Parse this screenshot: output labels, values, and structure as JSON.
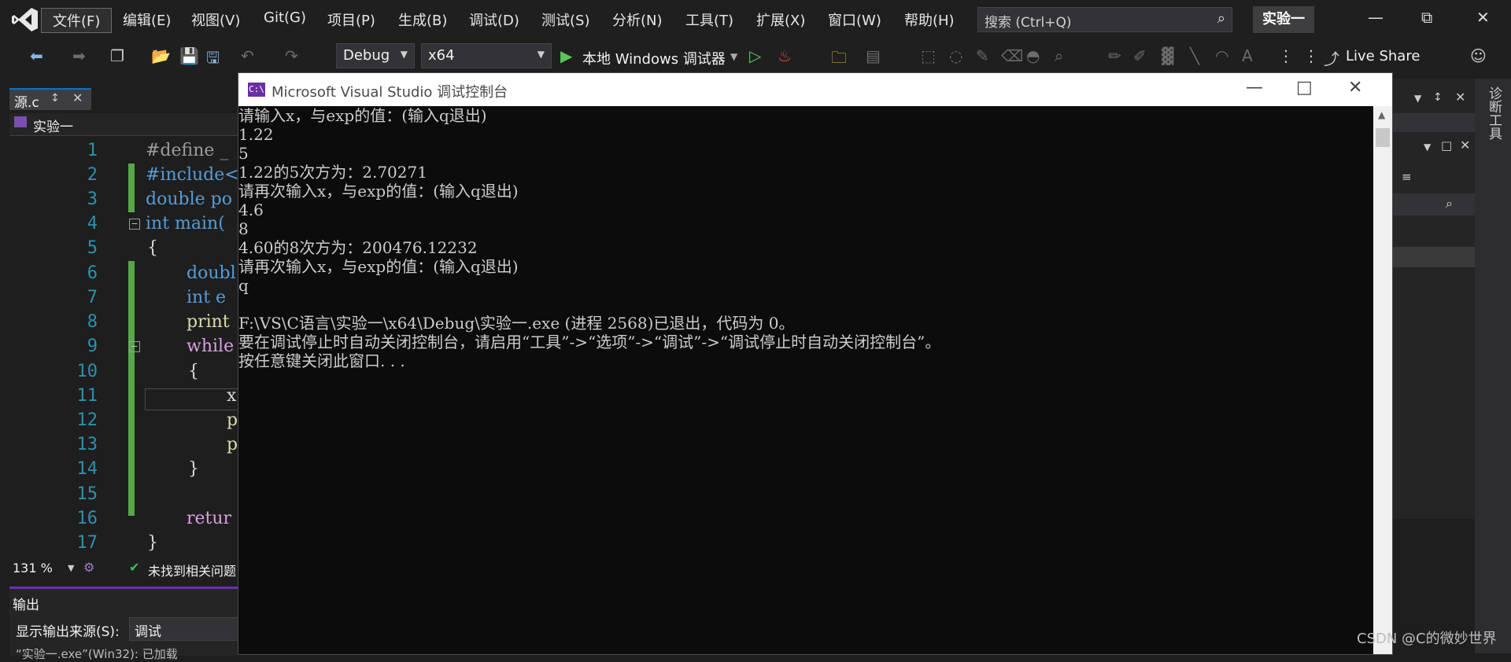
{
  "menubar": {
    "items": [
      "文件(F)",
      "编辑(E)",
      "视图(V)",
      "Git(G)",
      "项目(P)",
      "生成(B)",
      "调试(D)",
      "测试(S)",
      "分析(N)",
      "工具(T)",
      "扩展(X)",
      "窗口(W)",
      "帮助(H)"
    ],
    "search_placeholder": "搜索 (Ctrl+Q)",
    "solution_name": "实验一"
  },
  "toolbar": {
    "configuration": "Debug",
    "platform": "x64",
    "run_label": "本地 Windows 调试器",
    "live_share": "Live Share"
  },
  "editor": {
    "tab_label": "源.c",
    "nav_project": "实验一",
    "line_numbers": [
      "1",
      "2",
      "3",
      "4",
      "5",
      "6",
      "7",
      "8",
      "9",
      "10",
      "11",
      "12",
      "13",
      "14",
      "15",
      "16",
      "17"
    ],
    "lines": [
      "#define _",
      "#include<",
      "double po",
      "int main(",
      "{",
      "doubl",
      "int e",
      "print",
      "while",
      "{",
      "x",
      "p",
      "p",
      "}",
      "",
      "retur",
      "}"
    ],
    "zoom": "131 %",
    "status": "未找到相关问题"
  },
  "output": {
    "title": "输出",
    "source_label": "显示输出来源(S):",
    "source_value": "调试",
    "partial_line": "“实验一.exe”(Win32): 已加载"
  },
  "right_panel": {
    "diagnostics_label": "诊断工具"
  },
  "console": {
    "title": "Microsoft Visual Studio 调试控制台",
    "lines": [
      "请输入x，与exp的值：(输入q退出)",
      "1.22",
      "5",
      "1.22的5次方为：2.70271",
      "请再次输入x，与exp的值：(输入q退出)",
      "4.6",
      "8",
      "4.60的8次方为：200476.12232",
      "请再次输入x，与exp的值：(输入q退出)",
      "q",
      "",
      "F:\\VS\\C语言\\实验一\\x64\\Debug\\实验一.exe (进程 2568)已退出，代码为 0。",
      "要在调试停止时自动关闭控制台，请启用“工具”->“选项”->“调试”->“调试停止时自动关闭控制台”。",
      "按任意键关闭此窗口. . ."
    ]
  },
  "watermark": "CSDN @C的微妙世界",
  "colors": {
    "accent": "#0e70c0",
    "change_bar": "#57a64a",
    "keyword": "#569cd6",
    "console_bg": "#0c0c0c"
  }
}
